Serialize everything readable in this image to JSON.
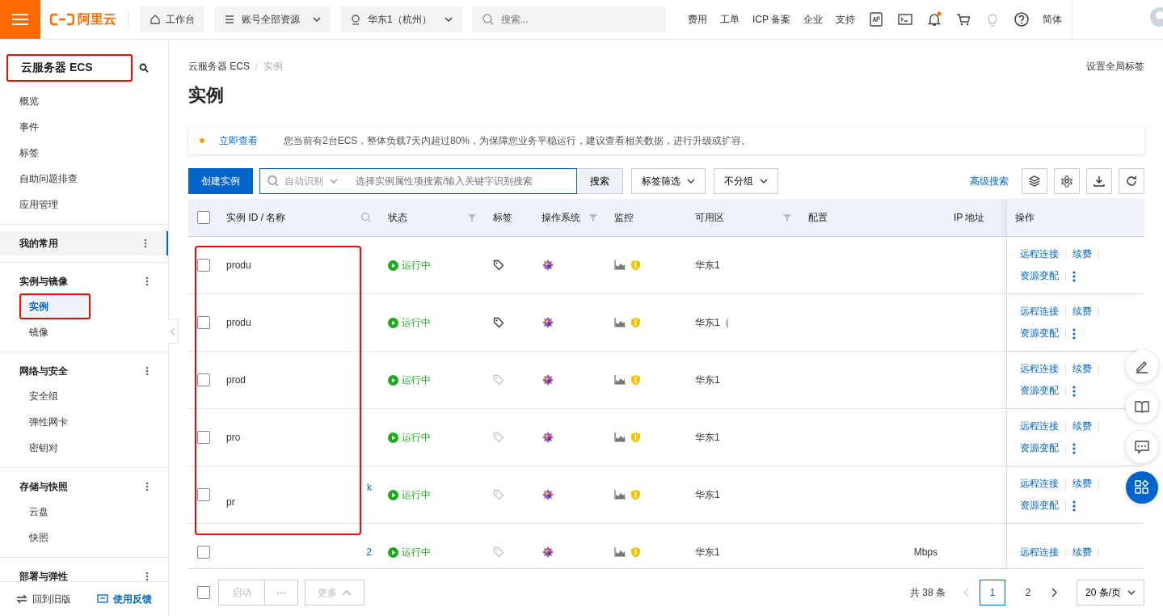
{
  "topbar": {
    "brand": "阿里云",
    "workbench": "工作台",
    "resource_scope": "账号全部资源",
    "region": "华东1（杭州）",
    "search": {
      "placeholder": "搜索..."
    },
    "links": [
      "费用",
      "工单",
      "ICP 备案",
      "企业",
      "支持"
    ],
    "icons": [
      {
        "kind": "app",
        "badge": false
      },
      {
        "kind": "terminal",
        "badge": false
      },
      {
        "kind": "bell",
        "badge": true
      },
      {
        "kind": "cart",
        "badge": false
      },
      {
        "kind": "bulb",
        "badge": false
      },
      {
        "kind": "help",
        "badge": false
      }
    ],
    "language": "简体"
  },
  "sidebar": {
    "title": "云服务器 ECS",
    "highlighted": true,
    "items": [
      {
        "label": "概览",
        "selected": false
      },
      {
        "label": "事件",
        "selected": false
      },
      {
        "label": "标签",
        "selected": false
      },
      {
        "label": "自助问题排查",
        "selected": false
      },
      {
        "label": "应用管理",
        "selected": false
      }
    ],
    "sections": [
      {
        "label": "我的常用",
        "selected": true
      },
      {
        "label": "实例与镜像",
        "selected": false,
        "children": [
          {
            "label": "实例",
            "selected": true,
            "highlighted": true
          },
          {
            "label": "镜像",
            "selected": false,
            "highlighted": false
          }
        ]
      },
      {
        "label": "网络与安全",
        "selected": false,
        "children": [
          {
            "label": "安全组",
            "selected": false,
            "highlighted": false
          },
          {
            "label": "弹性网卡",
            "selected": false,
            "highlighted": false
          },
          {
            "label": "密钥对",
            "selected": false,
            "highlighted": false
          }
        ]
      },
      {
        "label": "存储与快照",
        "selected": false,
        "children": [
          {
            "label": "云盘",
            "selected": false,
            "highlighted": false
          },
          {
            "label": "快照",
            "selected": false,
            "highlighted": false
          }
        ]
      },
      {
        "label": "部署与弹性",
        "selected": false
      }
    ],
    "footer": {
      "old_version": "回到旧版",
      "feedback": "使用反馈"
    }
  },
  "breadcrumb": [
    "云服务器 ECS",
    "实例"
  ],
  "global_tags": "设置全局标签",
  "page_title": "实例",
  "notice": {
    "link": "立即查看",
    "message": "您当前有2台ECS，整体负载7天内超过80%，为保障您业务平稳运行，建议查看相关数据，进行升级或扩容。"
  },
  "toolbar": {
    "create": "创建实例",
    "search_mode": "自动识别",
    "search": {
      "placeholder": "选择实例属性项搜索/输入关键字识别搜索"
    },
    "search_button": "搜索",
    "tag_filter": "标签筛选",
    "grouping": "不分组",
    "advanced": "高级搜索"
  },
  "table": {
    "checked": false,
    "columns": [
      {
        "label": "实例 ID / 名称",
        "kind": "searchable"
      },
      {
        "label": "状态",
        "kind": "filterable"
      },
      {
        "label": "标签",
        "kind": "plain"
      },
      {
        "label": "操作系统",
        "kind": "filterable"
      },
      {
        "label": "监控",
        "kind": "plain"
      },
      {
        "label": "可用区",
        "kind": "filterable"
      },
      {
        "label": "配置",
        "kind": "plain"
      },
      {
        "label": "IP 地址",
        "kind": "plain"
      },
      {
        "label": "操作",
        "kind": "plain"
      }
    ],
    "rows": [
      {
        "checked": false,
        "id": "",
        "name": "produ",
        "status": "运行中",
        "tagged": true,
        "zone": "华东1",
        "config": "",
        "actions": [
          "远程连接",
          "续费",
          "资源变配"
        ]
      },
      {
        "checked": false,
        "id": "",
        "name": "produ",
        "status": "运行中",
        "tagged": true,
        "zone": "华东1（",
        "config": "",
        "actions": [
          "远程连接",
          "续费",
          "资源变配"
        ]
      },
      {
        "checked": false,
        "id": "",
        "name": "prod",
        "status": "运行中",
        "tagged": false,
        "zone": "华东1",
        "config": "",
        "actions": [
          "远程连接",
          "续费",
          "资源变配"
        ]
      },
      {
        "checked": false,
        "id": "",
        "name": "pro",
        "status": "运行中",
        "tagged": false,
        "zone": "华东1",
        "config": "",
        "actions": [
          "远程连接",
          "续费",
          "资源变配"
        ]
      },
      {
        "checked": false,
        "id": "k",
        "name": "pr",
        "status": "运行中",
        "tagged": false,
        "zone": "华东1",
        "config": "",
        "actions": [
          "远程连接",
          "续费",
          "资源变配"
        ]
      },
      {
        "checked": false,
        "id": "2",
        "name": "",
        "status": "运行中",
        "tagged": false,
        "zone": "华东1",
        "config": "Mbps",
        "actions": [
          "远程连接",
          "续费"
        ]
      }
    ]
  },
  "footer": {
    "checked": false,
    "start": "启动",
    "more_dots": "···",
    "more": "更多",
    "total": "共 38 条",
    "pages": [
      {
        "label": "1",
        "selected": true
      },
      {
        "label": "2",
        "selected": false
      }
    ],
    "page_size": "20 条/页"
  }
}
